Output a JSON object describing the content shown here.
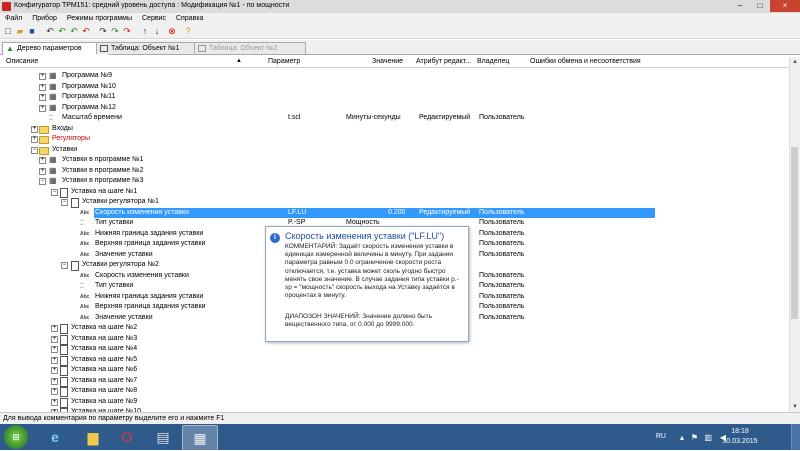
{
  "window": {
    "title": "Конфигуратор ТРМ151: средний уровень доступа : Модификация №1 - по мощности",
    "min": "–",
    "max": "□",
    "close": "×"
  },
  "menu": [
    "Файл",
    "Прибор",
    "Режимы программы",
    "Сервис",
    "Справка"
  ],
  "tabs": [
    {
      "label": "Дерево параметров",
      "active": true,
      "disabled": false
    },
    {
      "label": "Таблица: Объект №1",
      "active": false,
      "disabled": false
    },
    {
      "label": "Таблица: Объект №2",
      "active": false,
      "disabled": true
    }
  ],
  "columns": {
    "description": "Описание",
    "parameter": "Параметр",
    "value": "Значение",
    "attribute": "Атрибут редакт...",
    "owner": "Владелец",
    "errors": "Ошибки обмена и несоответствия"
  },
  "tree": [
    {
      "label": "Программа №9",
      "type": "tree"
    },
    {
      "label": "Программа №10",
      "type": "tree"
    },
    {
      "label": "Программа №11",
      "type": "tree"
    },
    {
      "label": "Программа №12",
      "type": "tree"
    },
    {
      "label": "Масштаб времени",
      "type": "kv",
      "param": "t.scl",
      "value": "Минуты-секунды",
      "attr": "Редактируемый",
      "owner": "Пользователь"
    },
    {
      "label": "Входы",
      "type": "folder"
    },
    {
      "label": "Регуляторы",
      "type": "folderred"
    },
    {
      "label": "Уставки",
      "type": "folder"
    },
    {
      "label": "Уставки в программе №1",
      "type": "tree"
    },
    {
      "label": "Уставки в программе №2",
      "type": "tree"
    },
    {
      "label": "Уставки в программе №3",
      "type": "tree"
    },
    {
      "label": "Уставка на шаге №1",
      "type": "doc"
    },
    {
      "label": "Уставки регулятора №1",
      "type": "chart"
    },
    {
      "label": "Скорость изменения уставки",
      "type": "abc",
      "param": "LF.LU",
      "value": "0.200",
      "attr": "Редактируемый",
      "owner": "Пользователь",
      "selected": true
    },
    {
      "label": "Тип уставки",
      "type": "kv",
      "param": "P.-SP",
      "value": "Мощность",
      "owner": "Пользователь"
    },
    {
      "label": "Нижняя граница задания уставки",
      "type": "abc",
      "owner": "Пользователь"
    },
    {
      "label": "Верхняя граница задания уставки",
      "type": "abc",
      "owner": "Пользователь"
    },
    {
      "label": "Значение уставки",
      "type": "abc",
      "owner": "Пользователь"
    },
    {
      "label": "Уставки регулятора №2",
      "type": "chart"
    },
    {
      "label": "Скорость изменения уставки",
      "type": "abc",
      "owner": "Пользователь"
    },
    {
      "label": "Тип уставки",
      "type": "kv",
      "owner": "Пользователь"
    },
    {
      "label": "Нижняя граница задания уставки",
      "type": "abc",
      "owner": "Пользователь"
    },
    {
      "label": "Верхняя граница задания уставки",
      "type": "abc",
      "owner": "Пользователь"
    },
    {
      "label": "Значение уставки",
      "type": "abc",
      "owner": "Пользователь"
    },
    {
      "label": "Уставка на шаге №2",
      "type": "doc"
    },
    {
      "label": "Уставка на шаге №3",
      "type": "doc"
    },
    {
      "label": "Уставка на шаге №4",
      "type": "doc"
    },
    {
      "label": "Уставка на шаге №5",
      "type": "doc"
    },
    {
      "label": "Уставка на шаге №6",
      "type": "doc"
    },
    {
      "label": "Уставка на шаге №7",
      "type": "doc"
    },
    {
      "label": "Уставка на шаге №8",
      "type": "doc"
    },
    {
      "label": "Уставка на шаге №9",
      "type": "doc"
    },
    {
      "label": "Уставка на шаге №10",
      "type": "doc"
    }
  ],
  "tooltip": {
    "title": "Скорость изменения уставки (\"LF.LU\")",
    "text": "КОММЕНТАРИЙ: Задаёт скорость изменения уставки в единицах измеренной величины в минуту. При задании параметра равным 0.0 ограничение скорости роста отключается, т.е. уставка может сколь угодно быстро менять свое значение. В случае задания типа уставки р.-sp = \"мощность\" скорость выхода на Уставку задаётся в процентах в минуту.",
    "range": "ДИАПОЗОН ЗНАЧЕНИЙ: Значение должно быть вещественного типа, от 0.000 до 9999.000."
  },
  "status": "Для вывода комментария по параметру выделите его и нажмите F1",
  "tray": {
    "lang": "RU",
    "time": "18:18",
    "date": "30.03.2015"
  }
}
